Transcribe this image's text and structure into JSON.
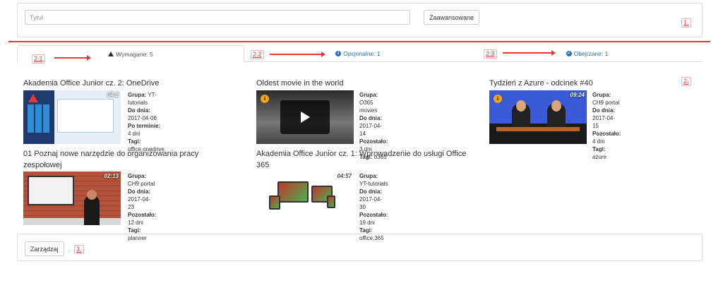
{
  "search": {
    "placeholder": "Tytuł",
    "advanced_label": "Zaawansowane"
  },
  "annotations": {
    "a1": "1.",
    "a2": "2.",
    "a3": "3.",
    "a21": "2.1",
    "a22": "2.2",
    "a23": "2.3"
  },
  "tabs": [
    {
      "label": "Wymagane: 5",
      "icon": "warning-icon"
    },
    {
      "label": "Opcjonalne: 1",
      "icon": "info-icon"
    },
    {
      "label": "Obejrzane: 1",
      "icon": "check-circle-icon"
    }
  ],
  "labels": {
    "group": "Grupa:",
    "due": "Do dnia:",
    "overdue": "Po terminie:",
    "remaining": "Pozostało:",
    "tags": "Tagi:"
  },
  "videos": [
    {
      "title": "Akademia Office Junior cz. 2: OneDrive",
      "duration": "04:2",
      "group": "YT-tutorials",
      "due": "2017-04-06",
      "status_value": "4 dni",
      "tags": "office,onedrive"
    },
    {
      "title": "Oldest movie in the world",
      "duration": "",
      "group": "O365 movies",
      "due": "2017-04-14",
      "status_value": "3 dni",
      "tags": "o365"
    },
    {
      "title": "Tydzień z Azure - odcinek #40",
      "duration": "09:24",
      "group": "CH9 portal",
      "due": "2017-04-15",
      "status_value": "4 dni",
      "tags": "azure"
    },
    {
      "title": "01 Poznaj nowe narzędzie do organizowania pracy zespołowej",
      "duration": "02:13",
      "group": "CH9 portal",
      "due": "2017-04-23",
      "status_value": "12 dni",
      "tags": "planner"
    },
    {
      "title": "Akademia Office Junior cz. 1: Wprowadzenie do usługi Office 365",
      "duration": "04:57",
      "group": "YT-tutorials",
      "due": "2017-04-30",
      "status_value": "19 dni",
      "tags": "office,365"
    }
  ],
  "footer": {
    "manage_label": "Zarządzaj"
  },
  "colors": {
    "annotation_red": "#e53935",
    "link_blue": "#2a73b8",
    "border": "#dddddd"
  }
}
